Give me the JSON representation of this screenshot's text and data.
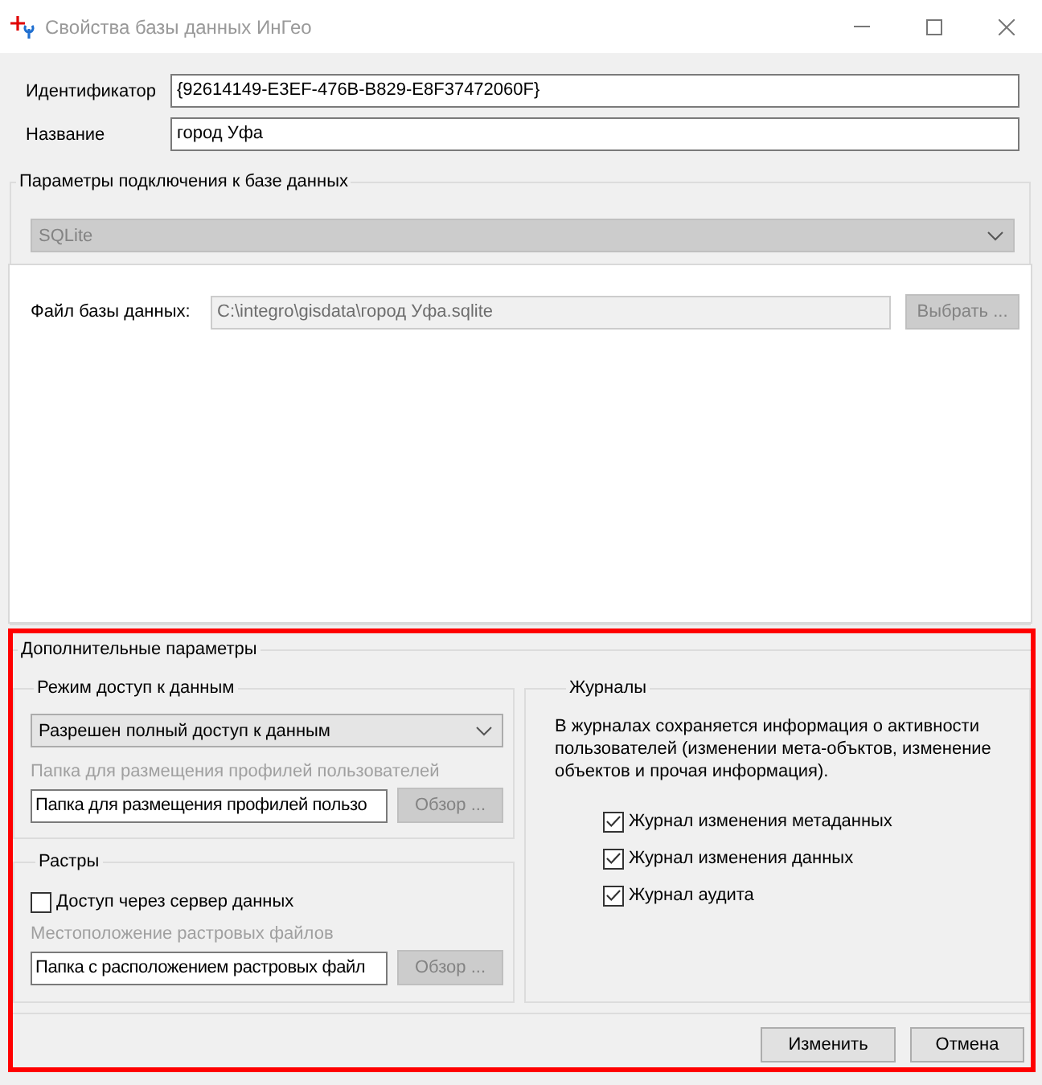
{
  "window": {
    "title": "Свойства базы данных ИнГео",
    "active": false
  },
  "fields": [
    {
      "label": "Идентификатор",
      "value": "{92614149-E3EF-476B-B829-E8F37472060F}"
    },
    {
      "label": "Название",
      "value": "город Уфа"
    }
  ],
  "connection": {
    "title": "Параметры подключения к базе данных",
    "provider": {
      "value": "SQLite",
      "disabled": true
    },
    "file": {
      "label": "Файл базы данных:",
      "value": "C:\\integro\\gisdata\\город Уфа.sqlite",
      "disabled": true
    },
    "browse_button": {
      "label": "Выбрать ...",
      "disabled": true
    }
  },
  "additional": {
    "title": "Дополнительные параметры",
    "highlighted": true,
    "access": {
      "title": "Режим доступ к данным",
      "mode": {
        "value": "Разрешен полный доступ к данным",
        "disabled": false
      },
      "folder_label": {
        "text": "Папка для размещения профилей пользователей",
        "disabled": true
      },
      "folder": {
        "value": "Папка для размещения профилей пользо"
      },
      "browse_button": {
        "label": "Обзор ...",
        "disabled": true
      }
    },
    "rasters": {
      "title": "Растры",
      "server_access": {
        "label": "Доступ через сервер данных",
        "checked": false
      },
      "folder_label": {
        "text": "Местоположение растровых файлов",
        "disabled": true
      },
      "folder": {
        "value": "Папка с расположением растровых файл"
      },
      "browse_button": {
        "label": "Обзор ...",
        "disabled": true
      }
    },
    "journals": {
      "title": "Журналы",
      "description": "В журналах сохраняется информация о активности пользователей (изменении мета-объктов, изменение объектов и прочая информация).",
      "items": [
        {
          "label": "Журнал изменения метаданных",
          "checked": true
        },
        {
          "label": "Журнал изменения данных",
          "checked": true
        },
        {
          "label": "Журнал аудита",
          "checked": true
        }
      ]
    }
  },
  "buttons": [
    {
      "label": "Изменить"
    },
    {
      "label": "Отмена"
    }
  ]
}
